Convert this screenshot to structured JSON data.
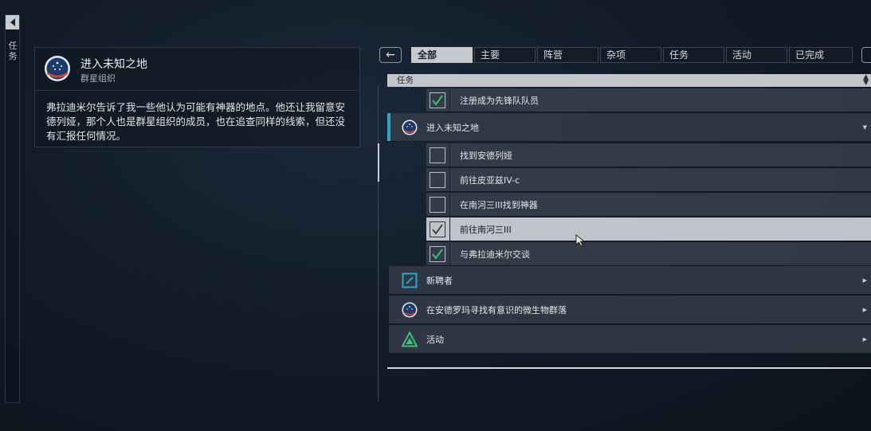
{
  "sidebar": {
    "label": "任务"
  },
  "detail": {
    "title": "进入未知之地",
    "faction": "群星组织",
    "description": "弗拉迪米尔告诉了我一些他认为可能有神器的地点。他还让我留意安德列娅，那个人也是群星组织的成员，也在追查同样的线索，但还没有汇报任何情况。"
  },
  "tabs": [
    {
      "label": "全部",
      "active": true
    },
    {
      "label": "主要",
      "active": false
    },
    {
      "label": "阵营",
      "active": false
    },
    {
      "label": "杂项",
      "active": false
    },
    {
      "label": "任务",
      "active": false
    },
    {
      "label": "活动",
      "active": false
    },
    {
      "label": "已完成",
      "active": false
    }
  ],
  "list": {
    "header": "任务",
    "top_objective": {
      "label": "注册成为先锋队队员",
      "done": true
    },
    "active_mission": {
      "label": "进入未知之地",
      "icon": "constellation-icon",
      "objectives": [
        {
          "label": "找到安德列娅",
          "done": false,
          "selected": false
        },
        {
          "label": "前往皮亚兹IV-c",
          "done": false,
          "selected": false
        },
        {
          "label": "在南河三III找到神器",
          "done": false,
          "selected": false
        },
        {
          "label": "前往南河三III",
          "done": true,
          "selected": true
        },
        {
          "label": "与弗拉迪米尔交谈",
          "done": true,
          "selected": false
        }
      ]
    },
    "other_missions": [
      {
        "label": "新聘者",
        "icon": "edit-square-icon"
      },
      {
        "label": "在安德罗玛寻找有意识的微生物群落",
        "icon": "constellation-icon"
      },
      {
        "label": "活动",
        "icon": "activity-triangle-icon"
      }
    ]
  },
  "colors": {
    "accent": "#2aa7c8",
    "check_green": "#3ec07a",
    "tab_active": "#c7cacd"
  }
}
